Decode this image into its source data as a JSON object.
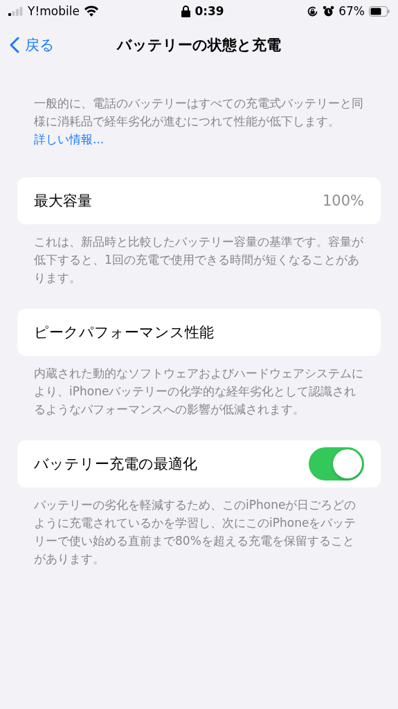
{
  "status_bar": {
    "carrier": "Y!mobile",
    "time": "0:39",
    "battery_percent": "67%"
  },
  "nav": {
    "back": "戻る",
    "title": "バッテリーの状態と充電"
  },
  "intro": {
    "text": "一般的に、電話のバッテリーはすべての充電式バッテリーと同様に消耗品で経年劣化が進むにつれて性能が低下します。",
    "link": "詳しい情報..."
  },
  "sections": [
    {
      "kind": "value",
      "label": "最大容量",
      "value": "100%",
      "footer": "これは、新品時と比較したバッテリー容量の基準です。容量が低下すると、1回の充電で使用できる時間が短くなることがあります。"
    },
    {
      "kind": "plain",
      "label": "ピークパフォーマンス性能",
      "footer": "内蔵された動的なソフトウェアおよびハードウェアシステムにより、iPhoneバッテリーの化学的な経年劣化として認識されるようなパフォーマンスへの影響が低減されます。"
    },
    {
      "kind": "toggle",
      "label": "バッテリー充電の最適化",
      "on": true,
      "footer": "バッテリーの劣化を軽減するため、このiPhoneが日ごろどのように充電されているかを学習し、次にこのiPhoneをバッテリーで使い始める直前まで80%を超える充電を保留することがあります。"
    }
  ]
}
